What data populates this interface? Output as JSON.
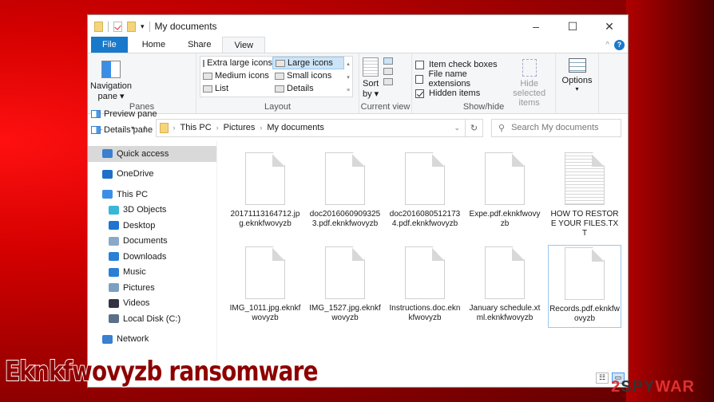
{
  "window": {
    "title": "My documents",
    "controls": {
      "minimize": "–",
      "maximize": "☐",
      "close": "✕"
    }
  },
  "ribbon": {
    "tabs": [
      {
        "label": "File"
      },
      {
        "label": "Home"
      },
      {
        "label": "Share"
      },
      {
        "label": "View",
        "active": true
      }
    ],
    "panes": {
      "label": "Panes",
      "navigation_pane": "Navigation",
      "navigation_pane2": "pane ▾",
      "preview_pane": "Preview pane",
      "details_pane": "Details pane"
    },
    "layout": {
      "label": "Layout",
      "items": [
        "Extra large icons",
        "Large icons",
        "Medium icons",
        "Small icons",
        "List",
        "Details"
      ],
      "selected": "Large icons"
    },
    "current_view": {
      "label": "Current view",
      "sort": "Sort",
      "sort2": "by ▾"
    },
    "show_hide": {
      "label": "Show/hide",
      "item_check_boxes": "Item check boxes",
      "file_name_extensions": "File name extensions",
      "hidden_items": "Hidden items",
      "hidden_items_checked": true,
      "hide_selected": "Hide selected",
      "hide_selected2": "items"
    },
    "options": {
      "label": "Options",
      "arrow": "▾"
    }
  },
  "address": {
    "breadcrumbs": [
      "This PC",
      "Pictures",
      "My documents"
    ],
    "search_placeholder": "Search My documents"
  },
  "sidebar": {
    "items": [
      {
        "label": "Quick access",
        "icon": "star-icon",
        "color": "#3a7fd0",
        "level": 0,
        "selected": true
      },
      {
        "label": "OneDrive",
        "icon": "cloud-icon",
        "color": "#1f6fc9",
        "level": 0
      },
      {
        "label": "This PC",
        "icon": "computer-icon",
        "color": "#3b8ee6",
        "level": 0
      },
      {
        "label": "3D Objects",
        "icon": "cube-icon",
        "color": "#38b6d8",
        "level": 1
      },
      {
        "label": "Desktop",
        "icon": "desktop-icon",
        "color": "#1e74d0",
        "level": 1
      },
      {
        "label": "Documents",
        "icon": "document-icon",
        "color": "#8aa8c8",
        "level": 1
      },
      {
        "label": "Downloads",
        "icon": "download-icon",
        "color": "#2a7fd6",
        "level": 1
      },
      {
        "label": "Music",
        "icon": "music-icon",
        "color": "#2a7fd6",
        "level": 1
      },
      {
        "label": "Pictures",
        "icon": "pictures-icon",
        "color": "#7aa0c0",
        "level": 1
      },
      {
        "label": "Videos",
        "icon": "video-icon",
        "color": "#334",
        "level": 1
      },
      {
        "label": "Local Disk (C:)",
        "icon": "disk-icon",
        "color": "#5a6f8a",
        "level": 1
      },
      {
        "label": "Network",
        "icon": "network-icon",
        "color": "#3a7fd0",
        "level": 0
      }
    ]
  },
  "files": [
    {
      "name": "20171113164712.jpg.eknkfwovyzb",
      "type": "blank"
    },
    {
      "name": "doc20160609093253.pdf.eknkfwovyzb",
      "type": "blank"
    },
    {
      "name": "doc20160805121734.pdf.eknkfwovyzb",
      "type": "blank"
    },
    {
      "name": "Expe.pdf.eknkfwovyzb",
      "type": "blank"
    },
    {
      "name": "HOW TO RESTORE YOUR FILES.TXT",
      "type": "text"
    },
    {
      "name": "IMG_1011.jpg.eknkfwovyzb",
      "type": "blank"
    },
    {
      "name": "IMG_1527.jpg.eknkfwovyzb",
      "type": "blank"
    },
    {
      "name": "Instructions.doc.eknkfwovyzb",
      "type": "blank"
    },
    {
      "name": "January schedule.xtml.eknkfwovyzb",
      "type": "blank"
    },
    {
      "name": "Records.pdf.eknkfwovyzb",
      "type": "blank",
      "focused": true
    }
  ],
  "overlay": {
    "banner": "Eknkfwovyzb ransomware",
    "watermark_a": "2",
    "watermark_b": "SPY",
    "watermark_c": "WAR"
  }
}
